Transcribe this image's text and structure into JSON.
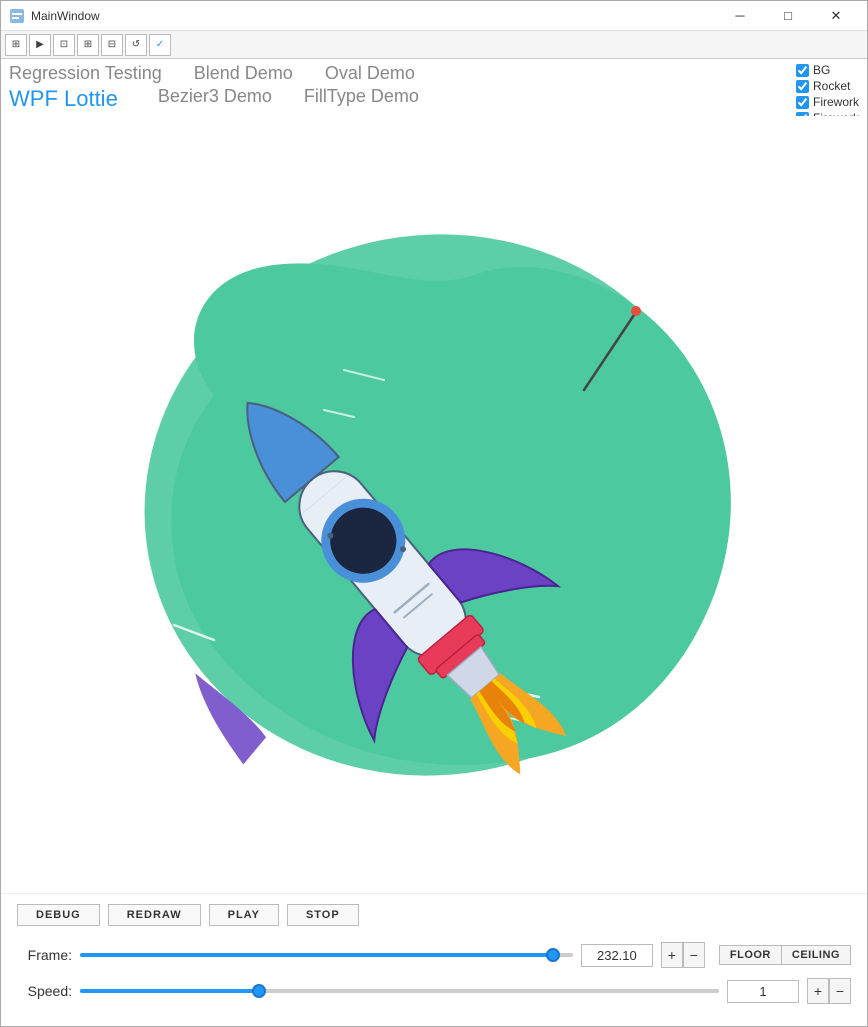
{
  "window": {
    "title": "MainWindow",
    "minimize_label": "─",
    "restore_label": "□",
    "close_label": "✕"
  },
  "toolbar": {
    "buttons": [
      "⊞",
      "▶",
      "⊡",
      "⊞",
      "⊟",
      "↺",
      "✓"
    ]
  },
  "menu": {
    "rows": [
      [
        {
          "label": "Regression Testing",
          "active": false
        },
        {
          "label": "Blend Demo",
          "active": false
        },
        {
          "label": "Oval Demo",
          "active": false
        }
      ],
      [
        {
          "label": "WPF Lottie",
          "active": true
        },
        {
          "label": "Bezier3 Demo",
          "active": false
        },
        {
          "label": "FillType Demo",
          "active": false
        }
      ]
    ]
  },
  "checkboxes": [
    {
      "label": "BG",
      "checked": true
    },
    {
      "label": "Rocket",
      "checked": true
    },
    {
      "label": "Firework",
      "checked": true
    },
    {
      "label": "Firework",
      "checked": true
    }
  ],
  "controls": {
    "debug_label": "DEBUG",
    "redraw_label": "REDRAW",
    "play_label": "PLAY",
    "stop_label": "STOP",
    "frame_label": "Frame:",
    "frame_value": "232.10",
    "frame_plus": "+",
    "frame_minus": "−",
    "floor_label": "FLOOR",
    "ceiling_label": "CEILING",
    "speed_label": "Speed:",
    "speed_value": "1",
    "speed_plus": "+",
    "speed_minus": "−",
    "frame_slider_pct": 96,
    "speed_slider_pct": 28
  }
}
